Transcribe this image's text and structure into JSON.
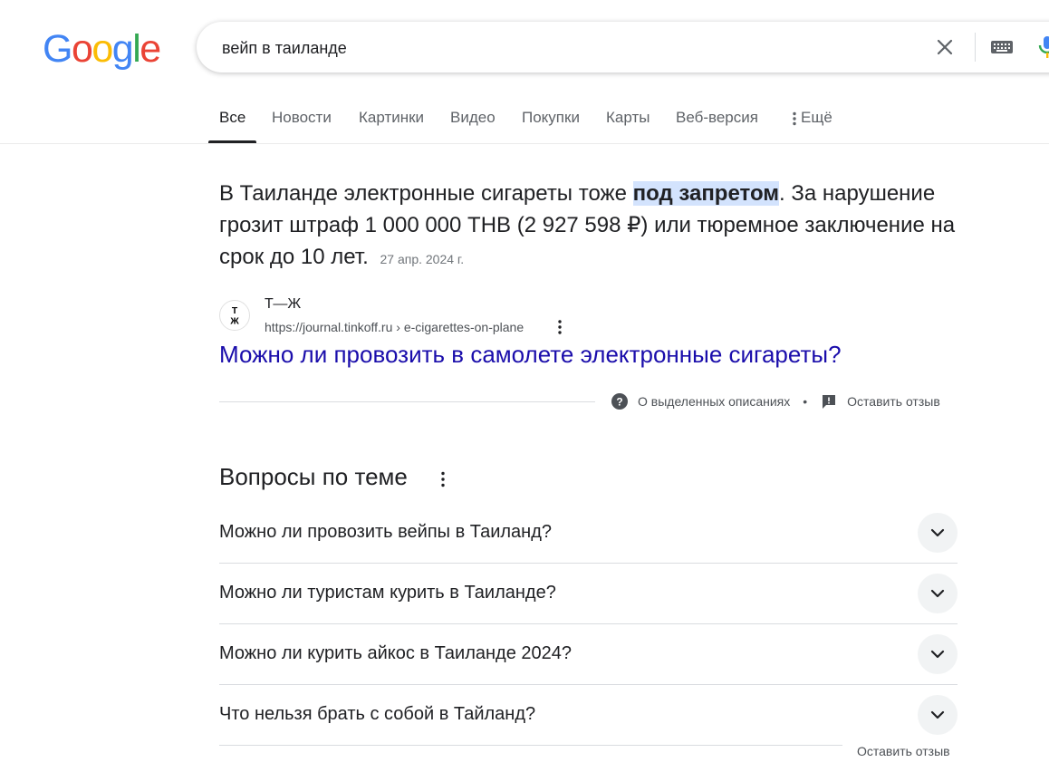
{
  "logo": {
    "letters": [
      "G",
      "o",
      "o",
      "g",
      "l",
      "e"
    ],
    "colors": [
      "#4285f4",
      "#ea4335",
      "#fbbc05",
      "#4285f4",
      "#34a853",
      "#ea4335"
    ]
  },
  "search": {
    "query": "вейп в таиланде"
  },
  "tabs": [
    {
      "label": "Все",
      "active": true
    },
    {
      "label": "Новости"
    },
    {
      "label": "Картинки"
    },
    {
      "label": "Видео"
    },
    {
      "label": "Покупки"
    },
    {
      "label": "Карты"
    },
    {
      "label": "Веб-версия"
    },
    {
      "label": "Ещё",
      "icon": "more-vert-icon"
    }
  ],
  "featured": {
    "text_before": "В Таиланде электронные сигареты тоже ",
    "highlight": "под запретом",
    "text_after": ". За нарушение грозит штраф 1 000 000 THB (2 927 598 ₽) или тюремное заключение на срок до 10 лет.",
    "date": "27 апр. 2024 г.",
    "source_name": "Т—Ж",
    "favicon_text": "Т\nЖ",
    "source_url": "https://journal.tinkoff.ru › e-cigarettes-on-plane",
    "title": "Можно ли провозить в самолете электронные сигареты?"
  },
  "feedback": {
    "about": "О выделенных описаниях",
    "separator": "•",
    "leave": "Оставить отзыв"
  },
  "paa": {
    "title": "Вопросы по теме",
    "items": [
      "Можно ли провозить вейпы в Таиланд?",
      "Можно ли туристам курить в Таиланде?",
      "Можно ли курить айкос в Таиланде 2024?",
      "Что нельзя брать с собой в Тайланд?"
    ],
    "feedback": "Оставить отзыв"
  },
  "colors": {
    "link": "#1a0dab",
    "highlight": "#d3e3fd",
    "text": "#202124",
    "secondary": "#4d5156"
  }
}
